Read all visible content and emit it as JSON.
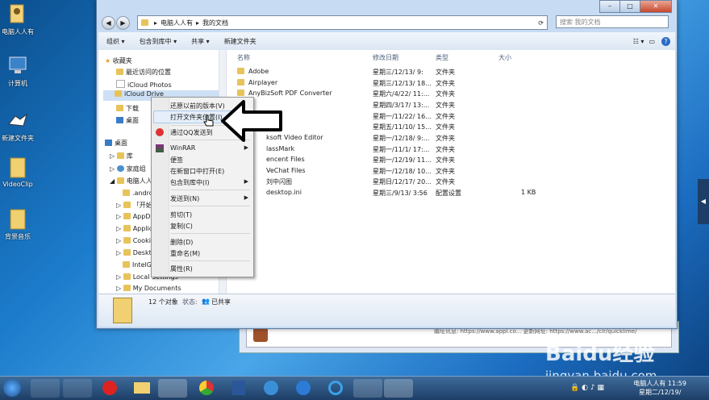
{
  "desktop": {
    "icons": [
      {
        "label": "电脑人人有",
        "icon": "user-folder-icon"
      },
      {
        "label": "计算机",
        "icon": "computer-icon"
      },
      {
        "label": "新建文件夹",
        "icon": "tiger-icon"
      },
      {
        "label": "VideoClip",
        "icon": "folder-icon"
      },
      {
        "label": "背景音乐",
        "icon": "folder-icon"
      }
    ]
  },
  "window": {
    "address": [
      "电脑人人有",
      "我的文档"
    ],
    "search_placeholder": "搜索 我的文档",
    "toolbar": {
      "organize": "组织 ▾",
      "include": "包含到库中 ▾",
      "share": "共享 ▾",
      "new_folder": "新建文件夹"
    },
    "nav": {
      "favorites": "收藏夹",
      "recent": "最近访问的位置",
      "icloud_photos": "iCloud Photos",
      "icloud_drive": "iCloud Drive",
      "downloads": "下载",
      "desktop_fav": "桌面",
      "desktop": "桌面",
      "library": "库",
      "homegroup": "家庭组",
      "user": "电脑人人",
      "sub": [
        ".andro",
        "「开始",
        "AppDa",
        "Applic",
        "Cookie",
        "Deskto",
        "IntelGr",
        "Local Settings",
        "My Documents"
      ]
    },
    "columns": {
      "name": "名称",
      "date": "修改日期",
      "type": "类型",
      "size": "大小"
    },
    "files": [
      {
        "name": "Adobe",
        "date": "星期三/12/13/ 9:",
        "type": "文件夹",
        "size": ""
      },
      {
        "name": "Airplayer",
        "date": "星期三/12/13/ 18...",
        "type": "文件夹",
        "size": ""
      },
      {
        "name": "AnyBizSoft PDF Converter",
        "date": "星期六/4/22/ 11:...",
        "type": "文件夹",
        "size": ""
      },
      {
        "name": "",
        "date": "星期四/3/17/ 13:...",
        "type": "文件夹",
        "size": ""
      },
      {
        "name": "",
        "date": "星期一/11/22/ 16...",
        "type": "文件夹",
        "size": ""
      },
      {
        "name": "",
        "date": "星期五/11/10/ 15...",
        "type": "文件夹",
        "size": ""
      },
      {
        "name": "ksoft Video Editor",
        "date": "星期一/12/18/ 9:...",
        "type": "文件夹",
        "size": ""
      },
      {
        "name": "lassMark",
        "date": "星期一/11/1/ 17:...",
        "type": "文件夹",
        "size": ""
      },
      {
        "name": "encent Files",
        "date": "星期一/12/19/ 11...",
        "type": "文件夹",
        "size": ""
      },
      {
        "name": "VeChat Files",
        "date": "星期一/12/18/ 10...",
        "type": "文件夹",
        "size": ""
      },
      {
        "name": "刘中闪图",
        "date": "星期日/12/17/ 20...",
        "type": "文件夹",
        "size": ""
      },
      {
        "name": "desktop.ini",
        "date": "星期三/9/13/ 3:56",
        "type": "配置设置",
        "size": "1 KB"
      }
    ],
    "status": {
      "count": "12 个对象",
      "state_label": "状态:",
      "state_value": "已共享"
    }
  },
  "context_menu": {
    "items": [
      {
        "label": "还原以前的版本(V)",
        "submenu": false
      },
      {
        "label": "打开文件夹位置(I)",
        "submenu": false,
        "highlighted": true
      },
      {
        "label": "通过QQ发送到",
        "submenu": false
      },
      {
        "label": "WinRAR",
        "submenu": true
      },
      {
        "label": "便签",
        "submenu": false
      },
      {
        "label": "在新窗口中打开(E)",
        "submenu": false
      },
      {
        "label": "包含到库中(I)",
        "submenu": true
      },
      {
        "label": "发送到(N)",
        "submenu": true
      },
      {
        "label": "剪切(T)",
        "submenu": false
      },
      {
        "label": "复制(C)",
        "submenu": false
      },
      {
        "label": "删除(D)",
        "submenu": false
      },
      {
        "label": "重命名(M)",
        "submenu": false
      },
      {
        "label": "属性(R)",
        "submenu": false
      }
    ]
  },
  "ghost_window": {
    "text": "编址讯息: https://www.appl.co...   更新网址: https://www.ac.../clr/quicklime/"
  },
  "taskbar": {
    "clock_time": "电脑人人有 11:59",
    "clock_date": "星期二/12/19/"
  },
  "watermark": {
    "brand": "Baidu经验",
    "url": "jingyan.baidu.com"
  },
  "colors": {
    "accent": "#1c7ccc",
    "highlight": "#e5eef9",
    "folder": "#e8c35a"
  }
}
